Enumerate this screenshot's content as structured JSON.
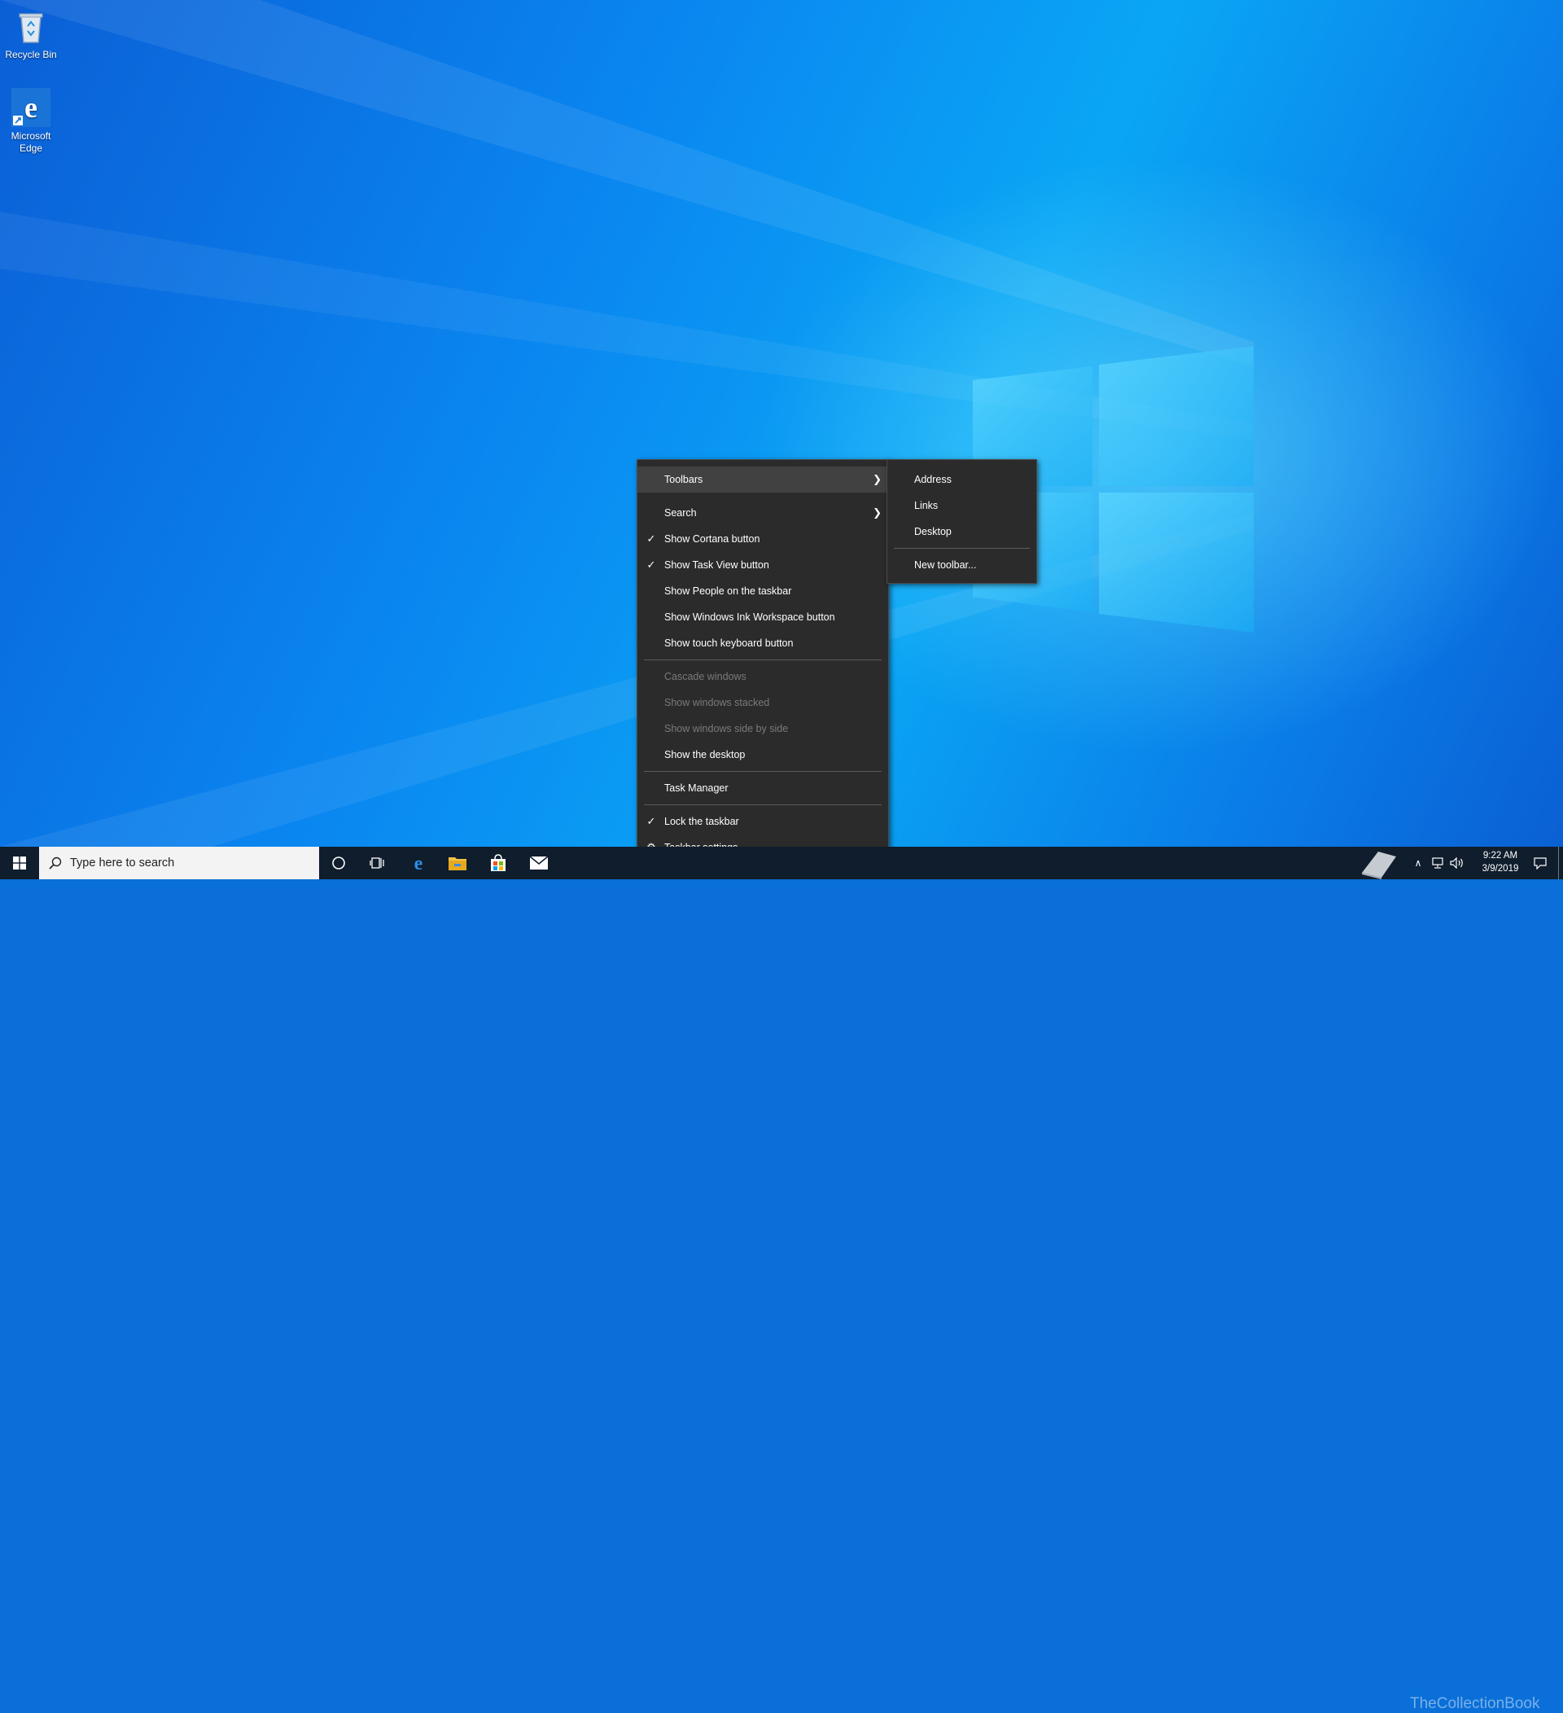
{
  "desktop": {
    "icons": [
      {
        "label": "Recycle Bin",
        "icon": "recycle-bin-icon"
      },
      {
        "label": "Microsoft Edge",
        "icon": "edge-icon"
      }
    ]
  },
  "context_menu": {
    "items": [
      {
        "label": "Toolbars",
        "submenu": true,
        "highlighted": true
      },
      {
        "label": "Search",
        "submenu": true
      },
      {
        "label": "Show Cortana button",
        "checked": true
      },
      {
        "label": "Show Task View button",
        "checked": true
      },
      {
        "label": "Show People on the taskbar"
      },
      {
        "label": "Show Windows Ink Workspace button"
      },
      {
        "label": "Show touch keyboard button"
      },
      {
        "label": "Cascade windows",
        "disabled": true
      },
      {
        "label": "Show windows stacked",
        "disabled": true
      },
      {
        "label": "Show windows side by side",
        "disabled": true
      },
      {
        "label": "Show the desktop"
      },
      {
        "label": "Task Manager"
      },
      {
        "label": "Lock the taskbar",
        "checked": true
      },
      {
        "label": "Taskbar settings",
        "icon": "gear-icon"
      }
    ]
  },
  "toolbars_submenu": {
    "items": [
      {
        "label": "Address"
      },
      {
        "label": "Links"
      },
      {
        "label": "Desktop"
      },
      {
        "label": "New toolbar..."
      }
    ]
  },
  "taskbar": {
    "search_placeholder": "Type here to search",
    "pinned": [
      "edge-icon",
      "file-explorer-icon",
      "store-icon",
      "mail-icon"
    ],
    "clock": {
      "time": "9:22 AM",
      "date": "3/9/2019"
    },
    "watermark": "TheCollectionBook"
  },
  "colors": {
    "menu_bg": "#2b2b2b",
    "menu_highlight": "#414141",
    "taskbar_bg": "#0f1d2d",
    "disabled_text": "#7a7a7a"
  }
}
